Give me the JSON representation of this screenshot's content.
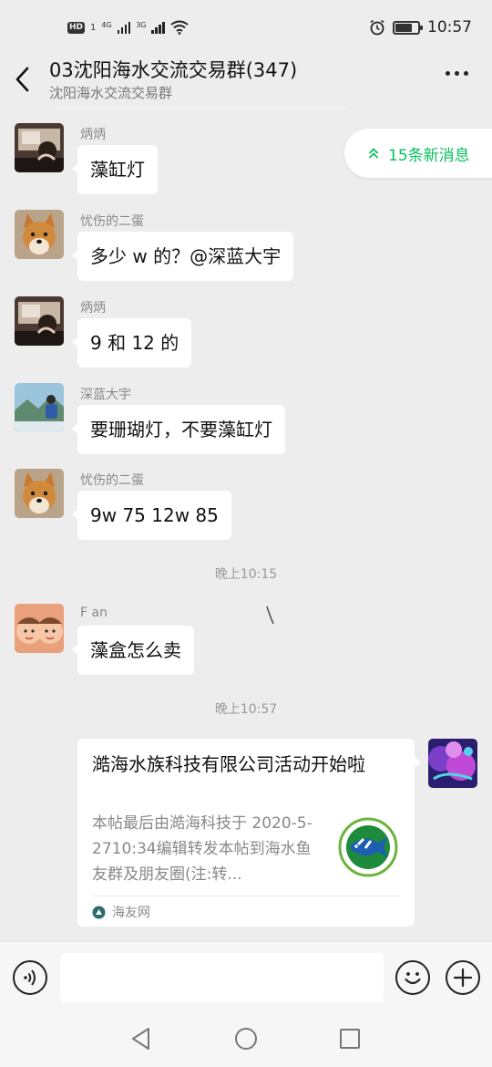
{
  "status_bar": {
    "hd_label": "HD",
    "hd_number": "1",
    "net1": "4G",
    "net2": "3G",
    "time": "10:57",
    "battery_level": 0.75
  },
  "header": {
    "title": "03沈阳海水交流交易群(347)",
    "subtitle": "沈阳海水交流交易群"
  },
  "new_messages": {
    "label": "15条新消息"
  },
  "messages": [
    {
      "nick": "炳炳",
      "text": "藻缸灯"
    },
    {
      "nick": "忧伤的二蛋",
      "text": "多少 w 的？@深蓝大宇"
    },
    {
      "nick": "炳炳",
      "text": "9 和 12 的"
    },
    {
      "nick": "深蓝大宇",
      "text": "要珊瑚灯，不要藻缸灯"
    },
    {
      "nick": "忧伤的二蛋",
      "text": "9w 75 12w 85"
    },
    {
      "nick": "F an",
      "text": "藻盒怎么卖"
    }
  ],
  "timestamps": [
    "晚上10:15",
    "晚上10:57"
  ],
  "link_card": {
    "title": "澔海水族科技有限公司活动开始啦",
    "description": "本帖最后由澔海科技于 2020-5-2710:34编辑转发本帖到海水鱼友群及朋友圈(注:转...",
    "source": "海友网"
  },
  "input": {
    "placeholder": ""
  },
  "colors": {
    "accent_green": "#07c160",
    "background": "#ededed",
    "bubble": "#ffffff"
  }
}
